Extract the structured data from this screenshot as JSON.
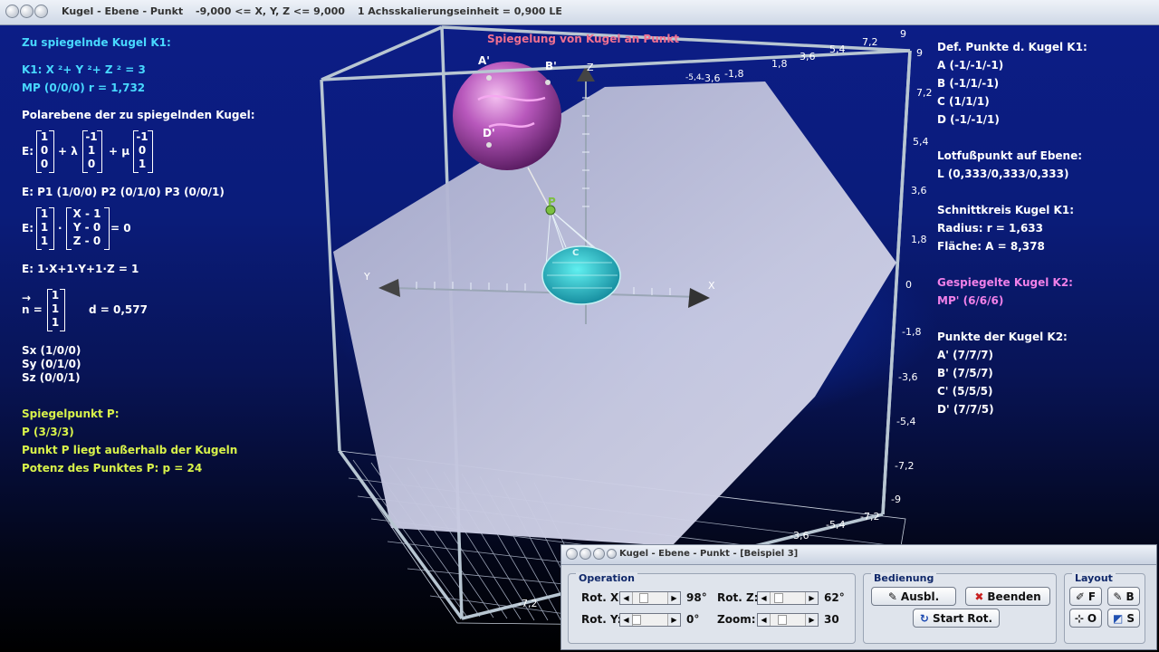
{
  "window": {
    "title": "Kugel - Ebene - Punkt",
    "range": "-9,000 <= X, Y, Z <= 9,000",
    "scale": "1 Achsskalierungseinheit = 0,900 LE"
  },
  "scene": {
    "heading": "Spiegelung von Kugel an Punkt",
    "axes": {
      "x": "X",
      "y": "Y",
      "z": "Z"
    },
    "points": {
      "a": "A'",
      "b": "B'",
      "d": "D'",
      "p": "P",
      "c": "C"
    },
    "ticks_right": [
      "9",
      "7,2",
      "5,4",
      "3,6",
      "1,8",
      "0",
      "-1,8",
      "-3,6",
      "-5,4",
      "-7,2",
      "-9"
    ],
    "ticks_top": [
      "-5,4",
      "-3,6",
      "-1,8",
      "1,8",
      "3,6",
      "5,4",
      "7,2",
      "9"
    ],
    "ticks_bottom": [
      "-3,6",
      "-5,4",
      "-7,2",
      "-7,2"
    ]
  },
  "left_panel": {
    "heading": "Zu spiegelnde Kugel K1:",
    "equation": "K1: X ²+ Y ²+ Z ² = 3",
    "center": "MP (0/0/0)  r = 1,732",
    "polar_heading": "Polarebene der zu spiegelnden Kugel:",
    "param": {
      "prefix": "E:",
      "v0": [
        "1",
        "0",
        "0"
      ],
      "lambda": "+ λ",
      "v1": [
        "-1",
        "1",
        "0"
      ],
      "mu": "+ μ",
      "v2": [
        "-1",
        "0",
        "1"
      ]
    },
    "points_line": "E: P1 (1/0/0)    P2 (0/1/0)    P3 (0/0/1)",
    "normal_form": {
      "prefix": "E:",
      "n": [
        "1",
        "1",
        "1"
      ],
      "dot": "·",
      "x": [
        "X - 1",
        "Y - 0",
        "Z - 0"
      ],
      "eq": "= 0"
    },
    "coord_form": "E: 1·X+1·Y+1·Z = 1",
    "nvec": {
      "arrow": "→",
      "name": "n =",
      "v": [
        "1",
        "1",
        "1"
      ],
      "d": "d = 0,577"
    },
    "intercepts": [
      "Sx (1/0/0)",
      "Sy (0/1/0)",
      "Sz (0/0/1)"
    ],
    "mirror_heading": "Spiegelpunkt P:",
    "mirror_point": "P (3/3/3)",
    "mirror_pos": "Punkt P liegt außerhalb der Kugeln",
    "power": "Potenz des Punktes P: p = 24"
  },
  "right_panel": {
    "def_heading": "Def. Punkte d. Kugel K1:",
    "def_points": [
      "A (-1/-1/-1)",
      "B (-1/1/-1)",
      "C (1/1/1)",
      "D (-1/-1/1)"
    ],
    "foot_heading": "Lotfußpunkt auf Ebene:",
    "foot_point": "L (0,333/0,333/0,333)",
    "circle_heading": "Schnittkreis Kugel K1:",
    "radius": "Radius: r = 1,633",
    "area": "Fläche: A = 8,378",
    "k2_heading": "Gespiegelte Kugel K2:",
    "k2_center": "MP' (6/6/6)",
    "k2_points_heading": "Punkte der Kugel K2:",
    "k2_points": [
      "A' (7/7/7)",
      "B' (7/5/7)",
      "C' (5/5/5)",
      "D' (7/7/5)"
    ]
  },
  "control": {
    "title": "Kugel - Ebene - Punkt - [Beispiel 3]",
    "operation": {
      "title": "Operation",
      "rot_x": {
        "label": "Rot. X:",
        "value": "98°",
        "level": 0.27
      },
      "rot_y": {
        "label": "Rot. Y:",
        "value": "0°",
        "level": 0.0
      },
      "rot_z": {
        "label": "Rot. Z:",
        "value": "62°",
        "level": 0.17
      },
      "zoom": {
        "label": "Zoom:",
        "value": "30",
        "level": 0.3
      }
    },
    "bedienung": {
      "title": "Bedienung",
      "ausbl": "Ausbl.",
      "beenden": "Beenden",
      "start_rot": "Start Rot."
    },
    "layout": {
      "title": "Layout",
      "f": "F",
      "b": "B",
      "o": "O",
      "s": "S"
    }
  },
  "colors": {
    "plane": "#b9bcd8",
    "sphere": "#c060c8",
    "cone": "#18b8c0",
    "cyan_text": "#48d8ff",
    "yellow_text": "#d8f24a",
    "pink_text": "#f080e8"
  }
}
